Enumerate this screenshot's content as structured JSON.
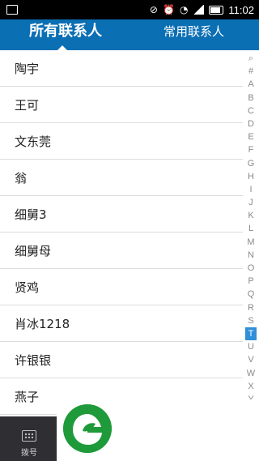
{
  "status_bar": {
    "time": "11:02"
  },
  "tabs": {
    "all_contacts": "所有联系人",
    "frequent_contacts": "常用联系人"
  },
  "contacts": [
    {
      "name": "陶宇"
    },
    {
      "name": "王可"
    },
    {
      "name": "文东莞"
    },
    {
      "name": "翁"
    },
    {
      "name": "细舅3"
    },
    {
      "name": "细舅母"
    },
    {
      "name": "贤鸡"
    },
    {
      "name": "肖冰1218"
    },
    {
      "name": "许银银"
    },
    {
      "name": "燕子"
    }
  ],
  "index_letters": [
    "#",
    "A",
    "B",
    "C",
    "D",
    "E",
    "F",
    "G",
    "H",
    "I",
    "J",
    "K",
    "L",
    "M",
    "N",
    "O",
    "P",
    "Q",
    "R",
    "S",
    "T",
    "U",
    "V",
    "W",
    "X",
    "Y"
  ],
  "index_active": "T",
  "bottom_bar": {
    "dial_label": "拨号"
  },
  "colors": {
    "accent": "#0b6fb4",
    "index_active": "#2f8fd8",
    "logo": "#1f9a3a"
  }
}
